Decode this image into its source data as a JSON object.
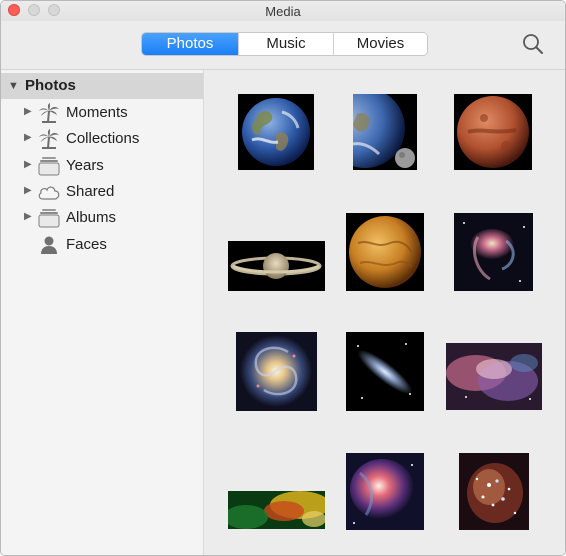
{
  "window": {
    "title": "Media"
  },
  "tabs": [
    {
      "label": "Photos",
      "active": true
    },
    {
      "label": "Music",
      "active": false
    },
    {
      "label": "Movies",
      "active": false
    }
  ],
  "sidebar": {
    "header": "Photos",
    "items": [
      {
        "label": "Moments",
        "icon": "palm-tree-icon",
        "expandable": true
      },
      {
        "label": "Collections",
        "icon": "palm-tree-icon",
        "expandable": true
      },
      {
        "label": "Years",
        "icon": "album-stack-icon",
        "expandable": true
      },
      {
        "label": "Shared",
        "icon": "cloud-icon",
        "expandable": true
      },
      {
        "label": "Albums",
        "icon": "album-stack-icon",
        "expandable": true
      },
      {
        "label": "Faces",
        "icon": "person-icon",
        "expandable": false
      }
    ]
  },
  "photos": [
    {
      "subject": "earth"
    },
    {
      "subject": "earth-and-moon"
    },
    {
      "subject": "mars"
    },
    {
      "subject": "saturn"
    },
    {
      "subject": "venus"
    },
    {
      "subject": "galaxy-collision"
    },
    {
      "subject": "spiral-galaxy"
    },
    {
      "subject": "andromeda-galaxy"
    },
    {
      "subject": "nebula"
    },
    {
      "subject": "colorful-nebula"
    },
    {
      "subject": "orion-nebula"
    },
    {
      "subject": "star-cluster"
    }
  ],
  "colors": {
    "accent": "#1a7ff6",
    "close_button": "#fd5f57",
    "sidebar_bg": "#f4f4f4",
    "content_bg": "#ececec"
  }
}
